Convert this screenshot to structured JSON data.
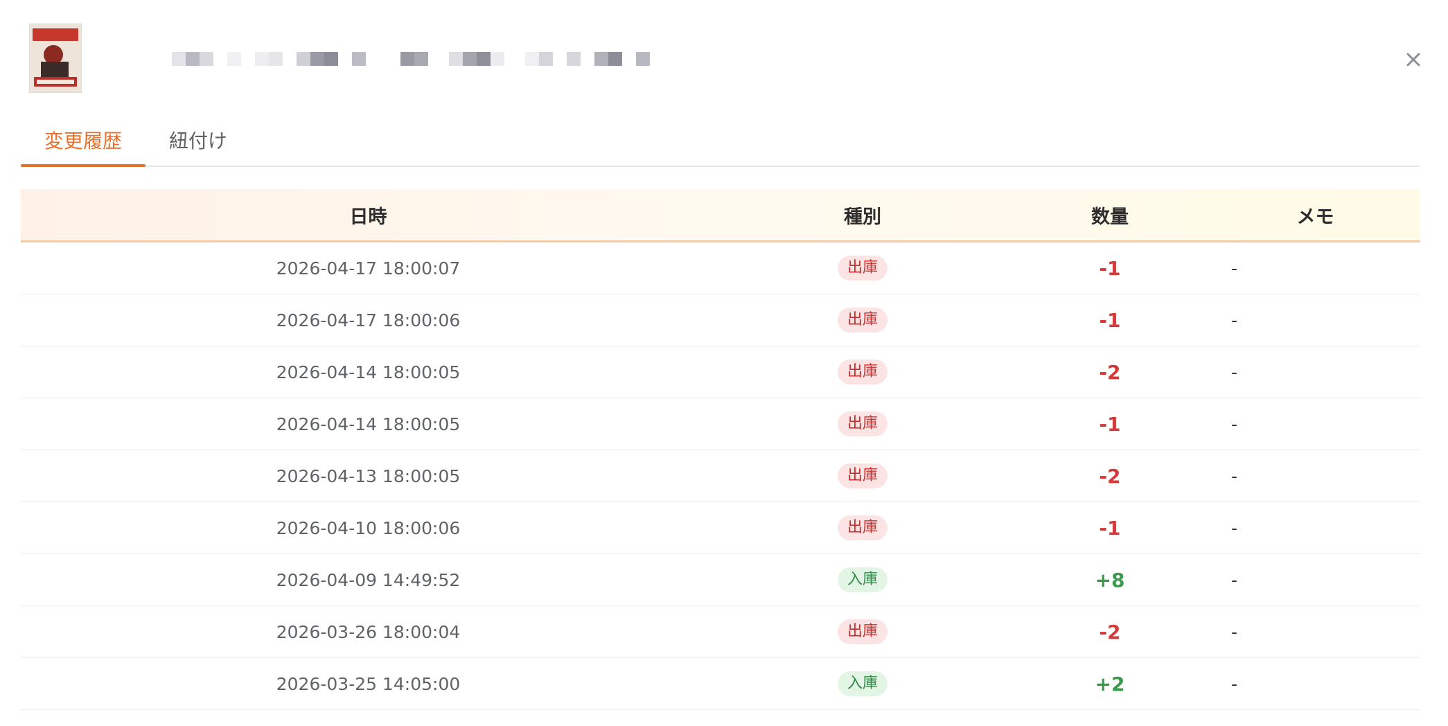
{
  "tabs": [
    {
      "label": "変更履歴",
      "active": true
    },
    {
      "label": "紐付け",
      "active": false
    }
  ],
  "close_icon": "close-icon",
  "table": {
    "headers": {
      "date": "日時",
      "type": "種別",
      "qty": "数量",
      "memo": "メモ"
    },
    "rows": [
      {
        "date": "2026-04-17 18:00:07",
        "type": "出庫",
        "kind": "out",
        "qty": "-1",
        "memo": "-"
      },
      {
        "date": "2026-04-17 18:00:06",
        "type": "出庫",
        "kind": "out",
        "qty": "-1",
        "memo": "-"
      },
      {
        "date": "2026-04-14 18:00:05",
        "type": "出庫",
        "kind": "out",
        "qty": "-2",
        "memo": "-"
      },
      {
        "date": "2026-04-14 18:00:05",
        "type": "出庫",
        "kind": "out",
        "qty": "-1",
        "memo": "-"
      },
      {
        "date": "2026-04-13 18:00:05",
        "type": "出庫",
        "kind": "out",
        "qty": "-2",
        "memo": "-"
      },
      {
        "date": "2026-04-10 18:00:06",
        "type": "出庫",
        "kind": "out",
        "qty": "-1",
        "memo": "-"
      },
      {
        "date": "2026-04-09 14:49:52",
        "type": "入庫",
        "kind": "in",
        "qty": "+8",
        "memo": "-"
      },
      {
        "date": "2026-03-26 18:00:04",
        "type": "出庫",
        "kind": "out",
        "qty": "-2",
        "memo": "-"
      },
      {
        "date": "2026-03-25 14:05:00",
        "type": "入庫",
        "kind": "in",
        "qty": "+2",
        "memo": "-"
      }
    ]
  },
  "colors": {
    "accent": "#e8702a",
    "out_text": "#c62f2f",
    "out_bg": "#fde4e4",
    "in_text": "#2e8b47",
    "in_bg": "#e3f6e6",
    "negative_qty": "#d23b3b",
    "positive_qty": "#3c9a4e"
  }
}
